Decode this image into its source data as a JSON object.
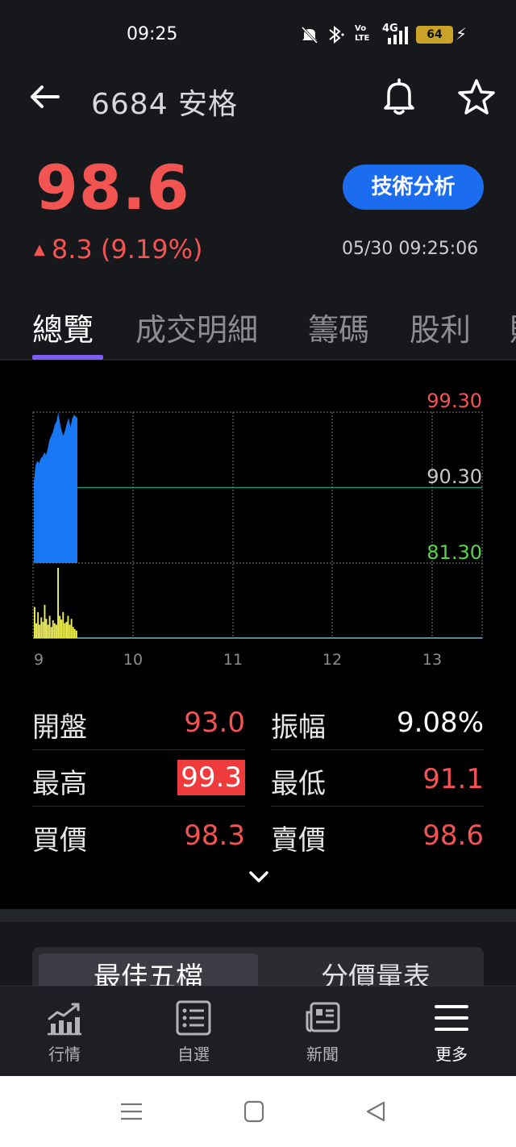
{
  "status_bar": {
    "time": "09:25",
    "signal_text": "4G",
    "volte_text": "Vo LTE",
    "battery": "64"
  },
  "header": {
    "title": "6684 安格",
    "back_icon": "arrow-left-icon",
    "bell_icon": "bell-icon",
    "star_icon": "star-icon"
  },
  "quote": {
    "price": "98.6",
    "change": "8.3 (9.19%)",
    "datetime": "05/30 09:25:06",
    "tech_button": "技術分析"
  },
  "tabs": [
    "總覽",
    "成交明細",
    "籌碼",
    "股利"
  ],
  "chart_data": {
    "type": "area",
    "price_labels": [
      "99.30",
      "90.30",
      "81.30"
    ],
    "x_ticks": [
      "9",
      "10",
      "11",
      "12",
      "13"
    ],
    "ylim": [
      81.3,
      99.3
    ],
    "reference_price": 90.3,
    "price_series": [
      91.1,
      93.0,
      93.5,
      93.2,
      93.8,
      94.0,
      94.5,
      94.2,
      95.0,
      96.0,
      96.5,
      97.0,
      97.8,
      98.2,
      99.3,
      98.0,
      97.0,
      96.5,
      97.2,
      98.0,
      98.6,
      97.5,
      98.5,
      99.0,
      98.8,
      98.6
    ],
    "volume_series": [
      42,
      20,
      35,
      18,
      28,
      22,
      45,
      26,
      18,
      30,
      15,
      24,
      20,
      18,
      95,
      30,
      25,
      35,
      20,
      22,
      30,
      18,
      26,
      15,
      12,
      10
    ],
    "colors": {
      "price_fill": "#1877f2",
      "volume_fill": "#eeee55",
      "reference_line": "#2b8a78",
      "high": "#f25452",
      "mid": "#c8c8c8",
      "low": "#5ad24a"
    }
  },
  "stats": {
    "open_label": "開盤",
    "open": "93.0",
    "amplitude_label": "振幅",
    "amplitude": "9.08%",
    "high_label": "最高",
    "high": "99.3",
    "low_label": "最低",
    "low": "91.1",
    "bid_label": "買價",
    "bid": "98.3",
    "ask_label": "賣價",
    "ask": "98.6"
  },
  "segment": {
    "best_five": "最佳五檔",
    "price_volume": "分價量表"
  },
  "bottom_nav": [
    {
      "label": "行情",
      "icon": "chart-icon"
    },
    {
      "label": "自選",
      "icon": "list-icon"
    },
    {
      "label": "新聞",
      "icon": "news-icon"
    },
    {
      "label": "更多",
      "icon": "menu-icon"
    }
  ],
  "colors": {
    "up": "#f25452",
    "accent": "#1c6cf0",
    "tab_indicator": "#7b5cf5"
  }
}
